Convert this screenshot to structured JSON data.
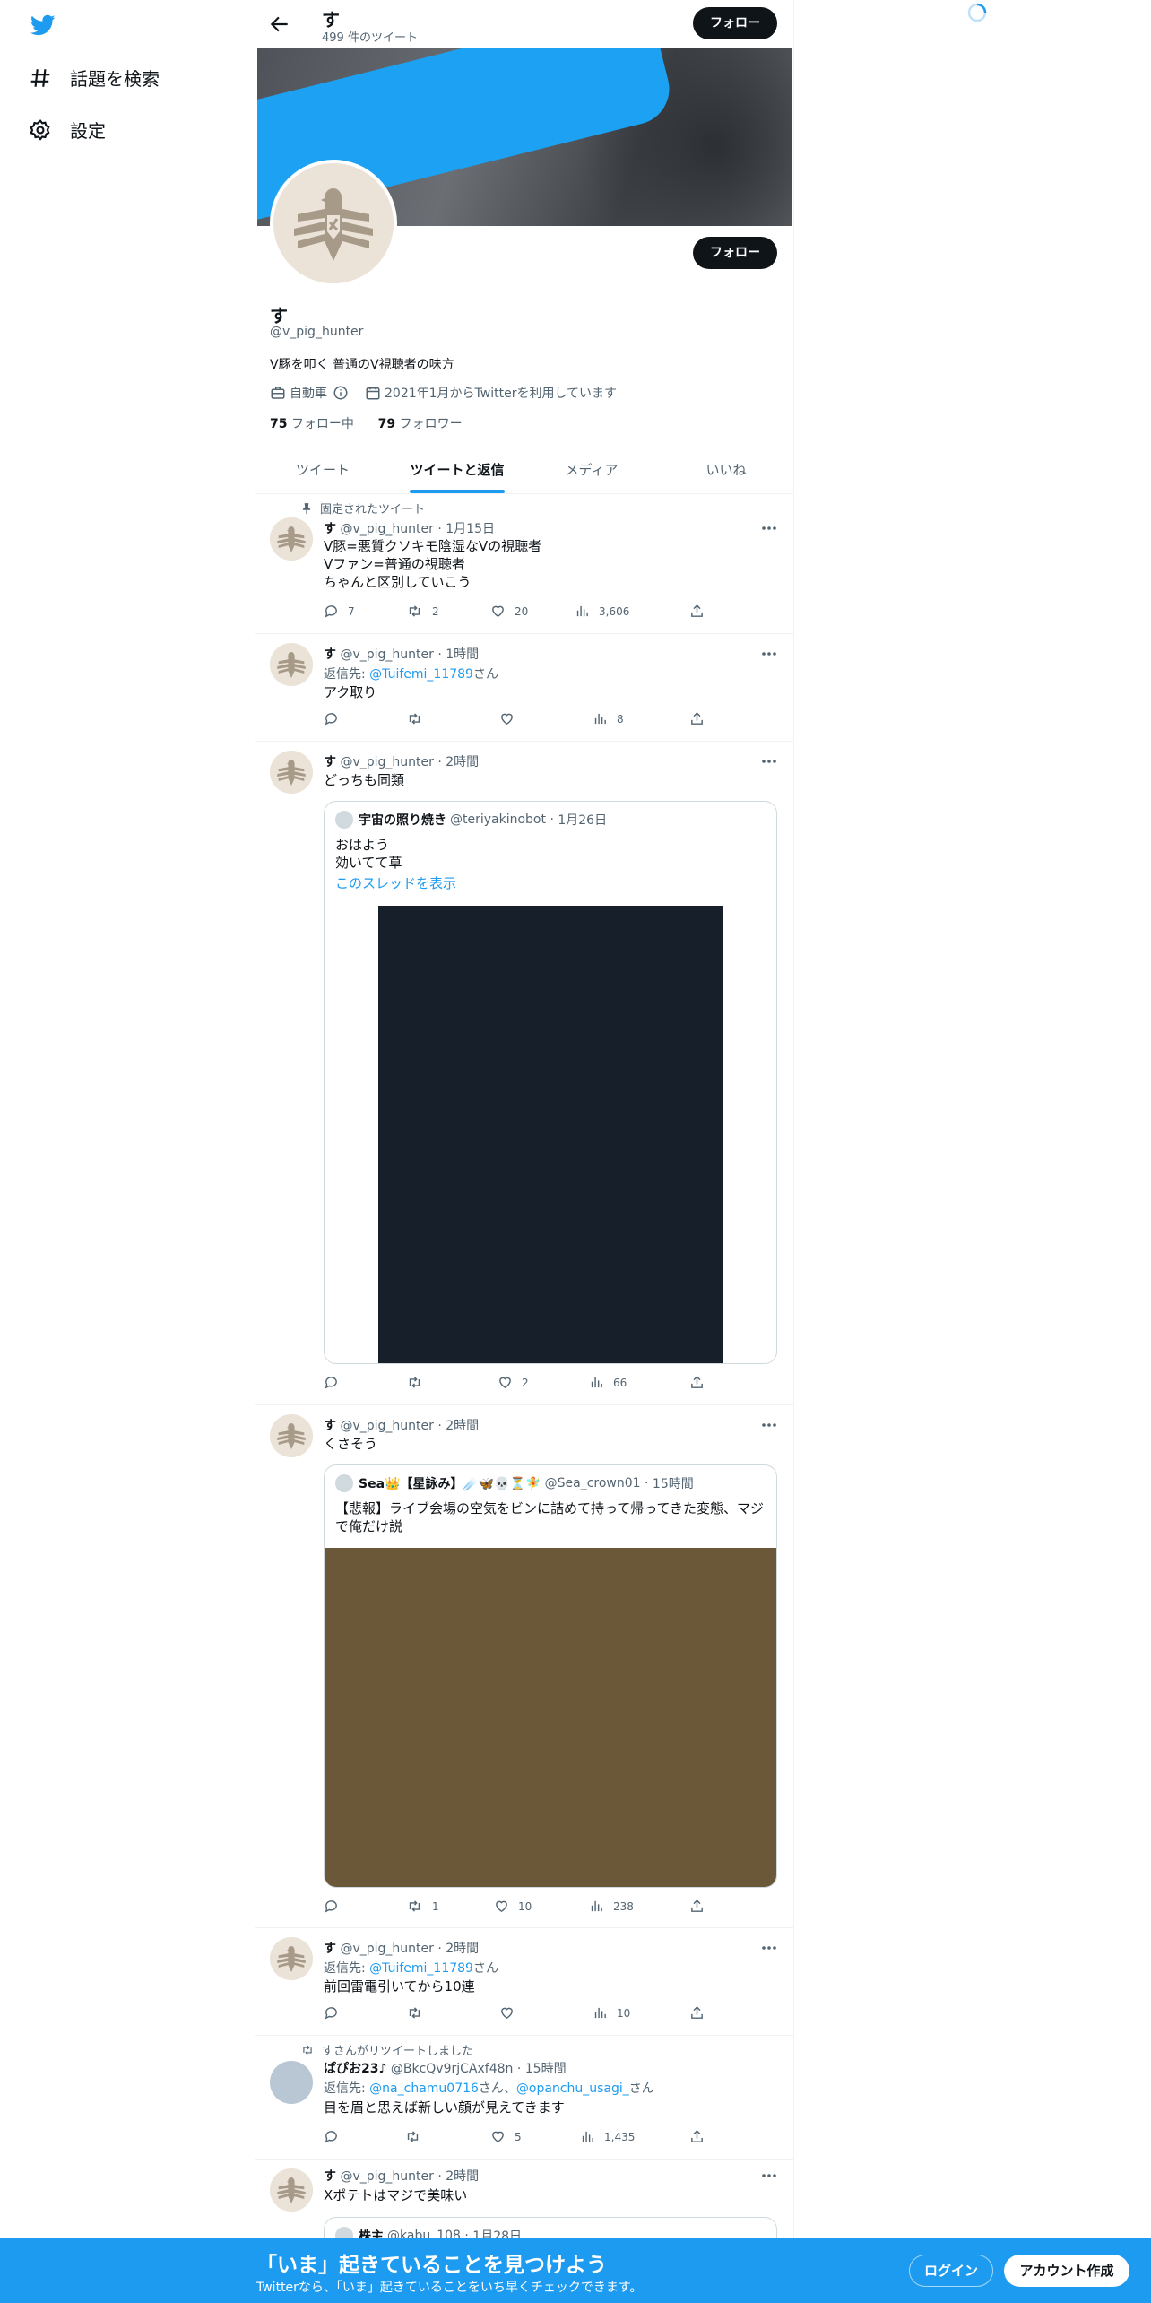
{
  "nav": {
    "logo": "twitter-bird-icon",
    "explore_label": "話題を検索",
    "settings_label": "設定"
  },
  "header": {
    "name": "す",
    "tweet_count": "499 件のツイート",
    "follow_label": "フォロー"
  },
  "profile": {
    "name": "す",
    "handle": "@v_pig_hunter",
    "bio": "V豚を叩く 普通のV視聴者の味方",
    "category": "自動車",
    "joined": "2021年1月からTwitterを利用しています",
    "following_count": "75",
    "following_label": "フォロー中",
    "followers_count": "79",
    "followers_label": "フォロワー",
    "follow_label": "フォロー"
  },
  "tabs": [
    {
      "label": "ツイート"
    },
    {
      "label": "ツイートと返信"
    },
    {
      "label": "メディア"
    },
    {
      "label": "いいね"
    }
  ],
  "colors": {
    "accent": "#1d9bf0",
    "dark": "#0f1419",
    "muted": "#536471"
  },
  "tweets": [
    {
      "context": "固定されたツイート",
      "name": "す",
      "handle": "@v_pig_hunter",
      "time": "1月15日",
      "text": "V豚=悪質クソキモ陰湿なVの視聴者\nVファン=普通の視聴者\nちゃんと区別していこう",
      "replies": "7",
      "retweets": "2",
      "likes": "20",
      "views": "3,606"
    },
    {
      "name": "す",
      "handle": "@v_pig_hunter",
      "time": "1時間",
      "reply_prefix": "返信先: ",
      "reply_to": "@Tuifemi_11789",
      "reply_suffix": "さん",
      "text": "アク取り",
      "views": "8"
    },
    {
      "name": "す",
      "handle": "@v_pig_hunter",
      "time": "2時間",
      "text": "どっちも同類",
      "quote": {
        "name": "宇宙の照り焼き",
        "handle": "@teriyakinobot",
        "time": "1月26日",
        "text": "おはよう\n効いてて草",
        "link": "このスレッドを表示"
      },
      "likes": "2",
      "views": "66"
    },
    {
      "name": "す",
      "handle": "@v_pig_hunter",
      "time": "2時間",
      "text": "くさそう",
      "quote": {
        "name": "Sea👑【星詠み】☄️🦋💀⏳🧚",
        "handle": "@Sea_crown01",
        "time": "15時間",
        "text": "【悲報】ライブ会場の空気をビンに詰めて持って帰ってきた変態、マジで俺だけ説"
      },
      "retweets": "1",
      "likes": "10",
      "views": "238"
    },
    {
      "name": "す",
      "handle": "@v_pig_hunter",
      "time": "2時間",
      "reply_prefix": "返信先: ",
      "reply_to": "@Tuifemi_11789",
      "reply_suffix": "さん",
      "text": "前回雷電引いてから10連",
      "views": "10"
    },
    {
      "context": "すさんがリツイートしました",
      "name": "ぱぴお23♪",
      "handle": "@BkcQv9rjCAxf48n",
      "time": "15時間",
      "reply_prefix": "返信先: ",
      "reply_to": "@na_chamu0716",
      "reply_mid": "さん、",
      "reply_to2": "@opanchu_usagi_",
      "reply_suffix": "さん",
      "text": "目を眉と思えば新しい顔が見えてきます",
      "likes": "5",
      "views": "1,435"
    },
    {
      "name": "す",
      "handle": "@v_pig_hunter",
      "time": "2時間",
      "text": "Xポテトはマジで美味い",
      "quote": {
        "name": "株主",
        "handle": "@kabu_108",
        "time": "1月28日"
      }
    }
  ],
  "bottom_bar": {
    "title": "「いま」起きていることを見つけよう",
    "subtitle": "Twitterなら、「いま」起きていることをいち早くチェックできます。",
    "login_label": "ログイン",
    "signup_label": "アカウント作成"
  }
}
